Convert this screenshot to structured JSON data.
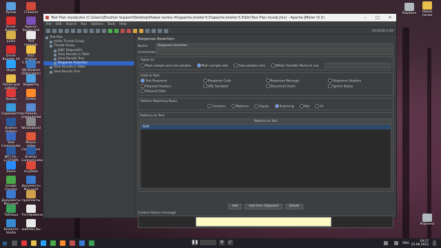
{
  "window": {
    "title": "Test Plan mysql.jmx (C:\\Users\\Zhuzhon Support\\Desktop\\Новая папка (4)\\apache-jmeter-5.5\\apache-jmeter-5.5\\bin\\Test Plan mysql.jmx) - Apache JMeter (5.5)",
    "menu": [
      "File",
      "Edit",
      "Search",
      "Run",
      "Options",
      "Tools",
      "Help"
    ],
    "toolbar_status": "00:00:00  0  0/0"
  },
  "tree": [
    {
      "label": "Test Plan",
      "depth": 0
    },
    {
      "label": "setUp Thread Group",
      "depth": 1
    },
    {
      "label": "Thread Group",
      "depth": 1
    },
    {
      "label": "JDBC Request01",
      "depth": 2
    },
    {
      "label": "View Results in Table",
      "depth": 2
    },
    {
      "label": "View Results Tree",
      "depth": 2
    },
    {
      "label": "Response Assertion",
      "depth": 2,
      "selected": true
    },
    {
      "label": "View Results in Table",
      "depth": 1
    },
    {
      "label": "View Results Tree",
      "depth": 1
    }
  ],
  "panel": {
    "heading": "Response Assertion",
    "name_label": "Name:",
    "name_value": "Response Assertion",
    "comments_label": "Comments:",
    "apply_to": {
      "title": "Apply to:",
      "options": [
        "Main sample and sub-samples",
        "Main sample only",
        "Sub-samples only",
        "JMeter Variable Name to use"
      ],
      "selected_index": 1
    },
    "field_to_test": {
      "title": "Field to Test",
      "options": [
        "Text Response",
        "Response Code",
        "Response Message",
        "Response Headers",
        "Request Headers",
        "URL Sampled",
        "Document (text)",
        "Ignore Status",
        "Request Data"
      ],
      "selected_index": 0
    },
    "pattern_matching": {
      "title": "Pattern Matching Rules",
      "options": [
        "Contains",
        "Matches",
        "Equals",
        "Substring",
        "Not",
        "Or"
      ],
      "selected_index": 3
    },
    "patterns": {
      "title": "Patterns to Test",
      "header": "Patterns to Test",
      "rows": [
        "NAN"
      ]
    },
    "buttons": [
      "Add",
      "Add from Clipboard",
      "Delete"
    ],
    "custom_failure_title": "Custom failure message"
  },
  "desktop_icons": [
    {
      "label": "Ярлык",
      "color": "#5aa0e0"
    },
    {
      "label": "CCleaner",
      "color": "#d04a3a"
    },
    {
      "label": "Driver Booster",
      "color": "#e0302e"
    },
    {
      "label": "Appium Server GUI",
      "color": "#7b4fb8"
    },
    {
      "label": "audio",
      "color": "#d7b04a"
    },
    {
      "label": "Test консоль",
      "color": "#eaeaea"
    },
    {
      "label": "Driver Booster 10",
      "color": "#e0302e"
    },
    {
      "label": "IDLE (Python 3.10 64-bit)",
      "color": "#f0c040"
    },
    {
      "label": "Skype",
      "color": "#2aa3ff"
    },
    {
      "label": "DB Browser (SQLCipher)",
      "color": "#3a7ac0"
    },
    {
      "label": "Папка для работы",
      "color": "#e8c04a"
    },
    {
      "label": "Виджеты",
      "color": "#4aa0e0"
    },
    {
      "label": "Yandex",
      "color": "#e03a3a"
    },
    {
      "label": "Firefox",
      "color": "#ff8a2a"
    },
    {
      "label": "Скриншоттер",
      "color": "#3a9ad9"
    },
    {
      "label": "Панель управления",
      "color": "#5a8ad0"
    },
    {
      "label": "Brother Utilities",
      "color": "#2a5aa0"
    },
    {
      "label": "WindowGrid",
      "color": "#8a8a8a"
    },
    {
      "label": "Total Commander",
      "color": "#3a6ac0"
    },
    {
      "label": "Mozaic Video Compressor",
      "color": "#e05a3a"
    },
    {
      "label": "MFC-HL-L2370DN",
      "color": "#2a5aa0"
    },
    {
      "label": "Brother ControlCenter",
      "color": "#2a5aa0"
    },
    {
      "label": "Zoom",
      "color": "#2a8cff"
    },
    {
      "label": "AnyDesk",
      "color": "#e04a3a"
    },
    {
      "label": "Google Chrome",
      "color": "#4aa84a"
    },
    {
      "label": "Документы Microsoft",
      "color": "#3a7ad0"
    },
    {
      "label": "Документы Microsoft",
      "color": "#3a7ad0"
    },
    {
      "label": "проспекты",
      "color": "#d0a04a"
    },
    {
      "label": "Таблица",
      "color": "#3aa05a"
    },
    {
      "label": "Тестирование",
      "color": "#e8e8e8"
    },
    {
      "label": "Blueprint Studio",
      "color": "#3a8ad0"
    },
    {
      "label": "шаблон_бы",
      "color": "#e8e8e8"
    }
  ],
  "right_icons": [
    {
      "label": "Корзина",
      "color": "#b0b8c0"
    },
    {
      "label": "Новая папка",
      "color": "#e8c04a"
    },
    {
      "label": "Корзина",
      "color": "#b0b8c0"
    }
  ],
  "taskbar": {
    "language": "ENG",
    "time": "19:27",
    "date": "22.06.2022"
  }
}
